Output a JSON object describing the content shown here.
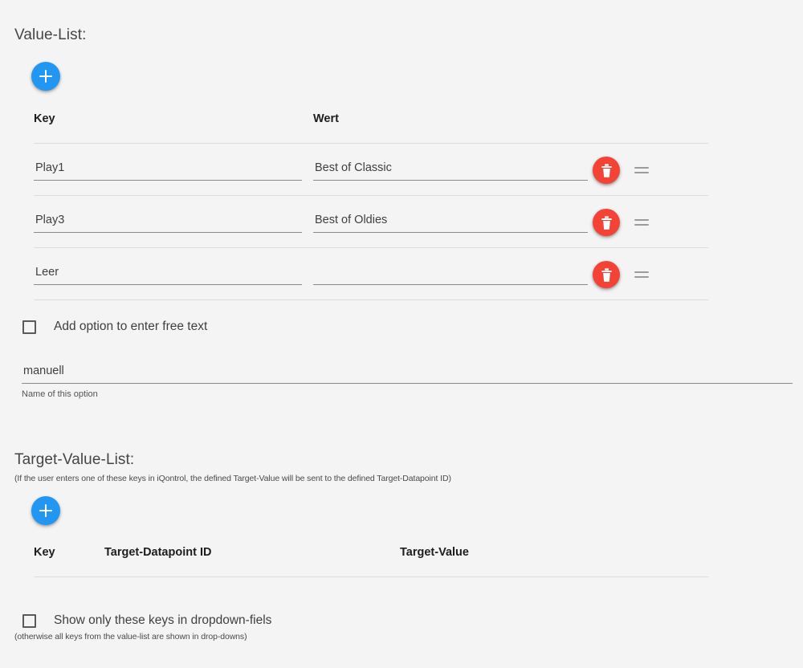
{
  "page": {
    "background_color": "#f4f4f4",
    "accent_blue": "#2196f3",
    "danger_red": "#f44336",
    "clipped_top_text": ""
  },
  "value_list": {
    "title": "Value-List:",
    "add_button_label": "+",
    "add_button_icon": "plus-icon",
    "columns": [
      "Key",
      "Wert"
    ],
    "rows": [
      {
        "key": "Play1",
        "key_placeholder": "",
        "value": "Best of Classic",
        "value_placeholder": "",
        "delete_icon": "trash-icon",
        "drag_icon": "drag-handle-icon"
      },
      {
        "key": "Play3",
        "key_placeholder": "",
        "value": "Best of Oldies",
        "value_placeholder": "",
        "delete_icon": "trash-icon",
        "drag_icon": "drag-handle-icon"
      },
      {
        "key": "Leer",
        "key_placeholder": "",
        "value": "",
        "value_placeholder": "",
        "delete_icon": "trash-icon",
        "drag_icon": "drag-handle-icon"
      }
    ]
  },
  "free_text": {
    "checkbox_label": "Add option to enter free text",
    "checked": false,
    "option_name_value": "manuell",
    "option_name_placeholder": "",
    "option_name_helper": "Name of this option"
  },
  "target_value_list": {
    "title": "Target-Value-List:",
    "hint": "(If the user enters one of these keys in iQontrol, the defined Target-Value will be sent to the defined Target-Datapoint ID)",
    "add_button_label": "+",
    "add_button_icon": "plus-icon",
    "columns": [
      "Key",
      "Target-Datapoint ID",
      "Target-Value"
    ],
    "rows": []
  },
  "show_only_keys": {
    "checkbox_label": "Show only these keys in dropdown-fiels",
    "checked": false,
    "hint": "(otherwise all keys from the value-list are shown in drop-downs)"
  }
}
